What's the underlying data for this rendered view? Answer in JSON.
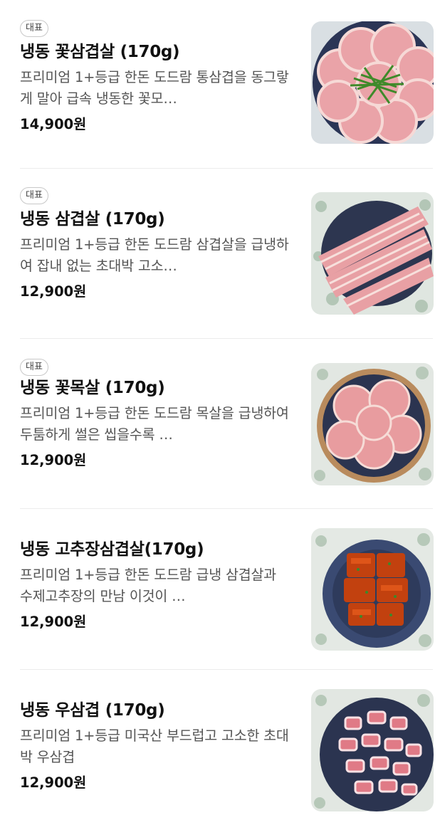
{
  "menu": {
    "items": [
      {
        "badge": "대표",
        "name": "냉동 꽃삼겹살 (170g)",
        "description": "프리미엄 1+등급 한돈 도드람 통삼겹을 동그랗게 말아 급속 냉동한 꽃모…",
        "price": "14,900원",
        "image": "rolled-pork-belly-with-chives-image"
      },
      {
        "badge": "대표",
        "name": "냉동 삼겹살 (170g)",
        "description": "프리미엄 1+등급 한돈 도드람 삼겹살을 급냉하여 잡내 없는 초대박 고소…",
        "price": "12,900원",
        "image": "sliced-pork-belly-image"
      },
      {
        "badge": "대표",
        "name": "냉동 꽃목살 (170g)",
        "description": "프리미엄 1+등급 한돈 도드람 목살을 급냉하여 두툼하게 썰은 씹을수록 …",
        "price": "12,900원",
        "image": "pork-neck-image"
      },
      {
        "badge": "",
        "name": "냉동 고추장삼겹살(170g)",
        "description": "프리미엄 1+등급 한돈 도드람 급냉 삼겹살과 수제고추장의 만남 이것이 …",
        "price": "12,900원",
        "image": "gochujang-pork-belly-image"
      },
      {
        "badge": "",
        "name": "냉동 우삼겹 (170g)",
        "description": "프리미엄 1+등급 미국산 부드럽고 고소한 초대박 우삼겹",
        "price": "12,900원",
        "image": "beef-brisket-image"
      }
    ]
  },
  "colors": {
    "text": "#111111",
    "description": "#555555",
    "divider": "#ececec",
    "badge_border": "#c8c8c8"
  }
}
